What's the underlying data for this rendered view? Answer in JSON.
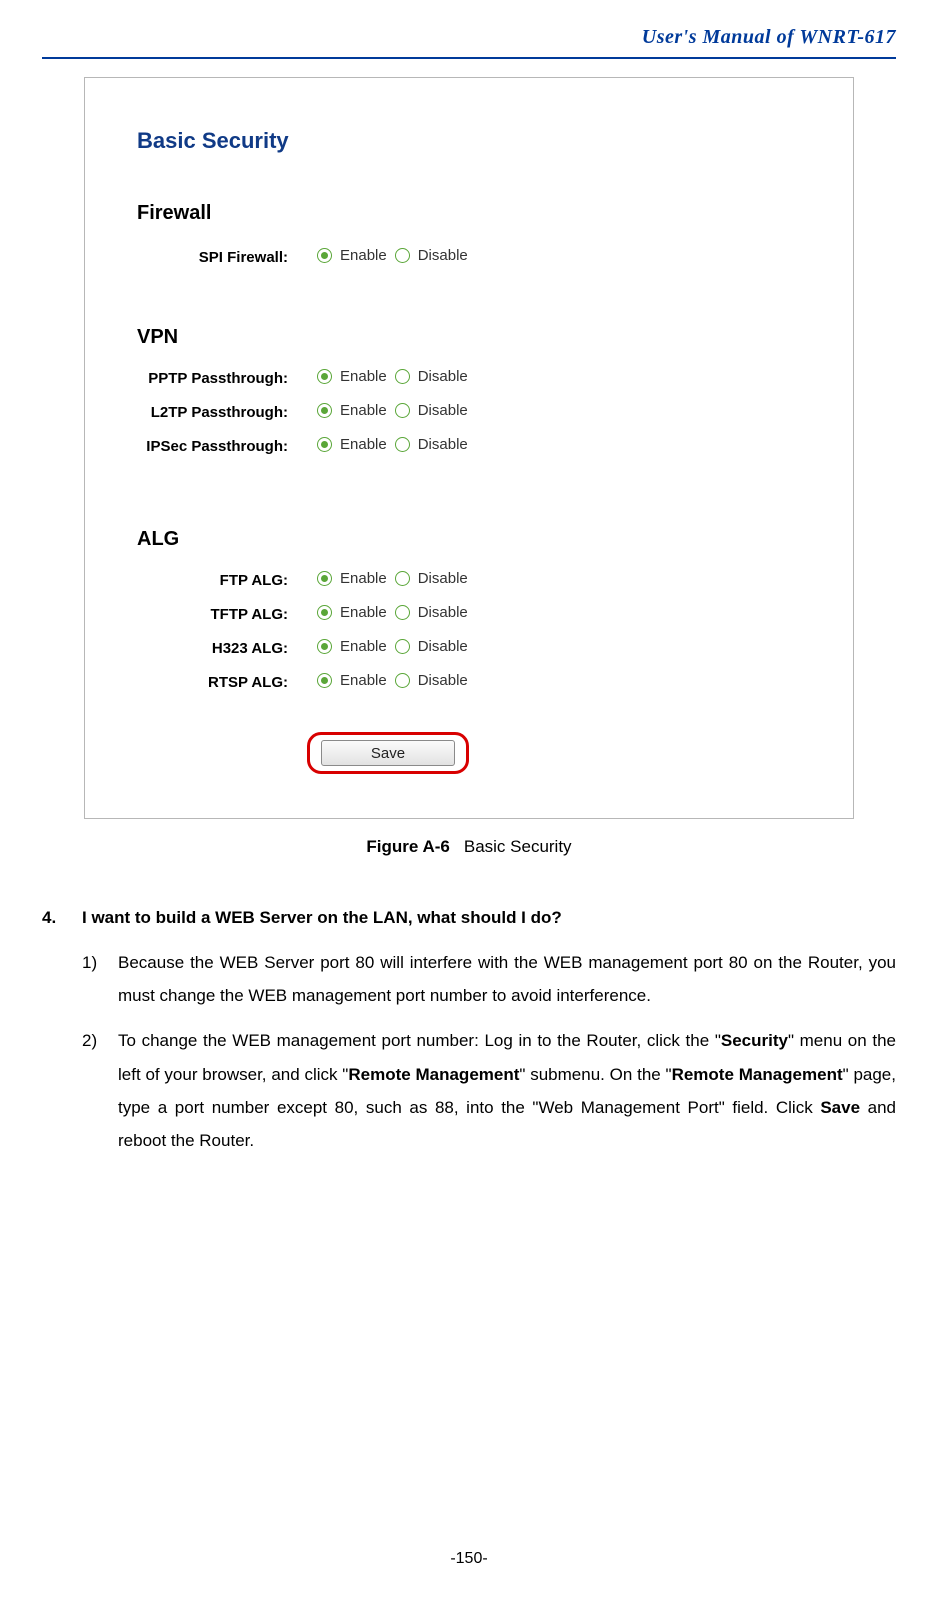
{
  "header": {
    "title": "User's  Manual  of  WNRT-617"
  },
  "screenshot": {
    "panel_title": "Basic Security",
    "sections": {
      "firewall": "Firewall",
      "vpn": "VPN",
      "alg": "ALG"
    },
    "option_labels": {
      "enable": "Enable",
      "disable": "Disable"
    },
    "rows": {
      "spi": {
        "label": "SPI Firewall:",
        "selected": "enable"
      },
      "pptp": {
        "label": "PPTP Passthrough:",
        "selected": "enable"
      },
      "l2tp": {
        "label": "L2TP Passthrough:",
        "selected": "enable"
      },
      "ipsec": {
        "label": "IPSec Passthrough:",
        "selected": "enable"
      },
      "ftp": {
        "label": "FTP ALG:",
        "selected": "enable"
      },
      "tftp": {
        "label": "TFTP ALG:",
        "selected": "enable"
      },
      "h323": {
        "label": "H323 ALG:",
        "selected": "enable"
      },
      "rtsp": {
        "label": "RTSP ALG:",
        "selected": "enable"
      }
    },
    "save_label": "Save"
  },
  "figure": {
    "label": "Figure A-6",
    "caption": "Basic Security"
  },
  "faq": {
    "number": "4.",
    "question": "I want to build a WEB Server on the LAN, what should I do?",
    "steps": {
      "s1": {
        "num": "1)",
        "text": "Because the WEB Server port 80 will interfere with the WEB management port 80 on the Router, you must change the WEB management port number to avoid interference."
      },
      "s2": {
        "num": "2)",
        "pre1": "To change the WEB management port number: Log in to the Router, click the \"",
        "bold1": "Security",
        "mid1": "\" menu on the left of your browser, and click \"",
        "bold2": "Remote Management",
        "mid2": "\" submenu. On the \"",
        "bold3": "Remote Management",
        "mid3": "\" page, type a port number except 80, such as 88, into the \"Web Management Port\" field. Click ",
        "bold4": "Save",
        "post": " and reboot the Router."
      }
    }
  },
  "page_number": "-150-"
}
